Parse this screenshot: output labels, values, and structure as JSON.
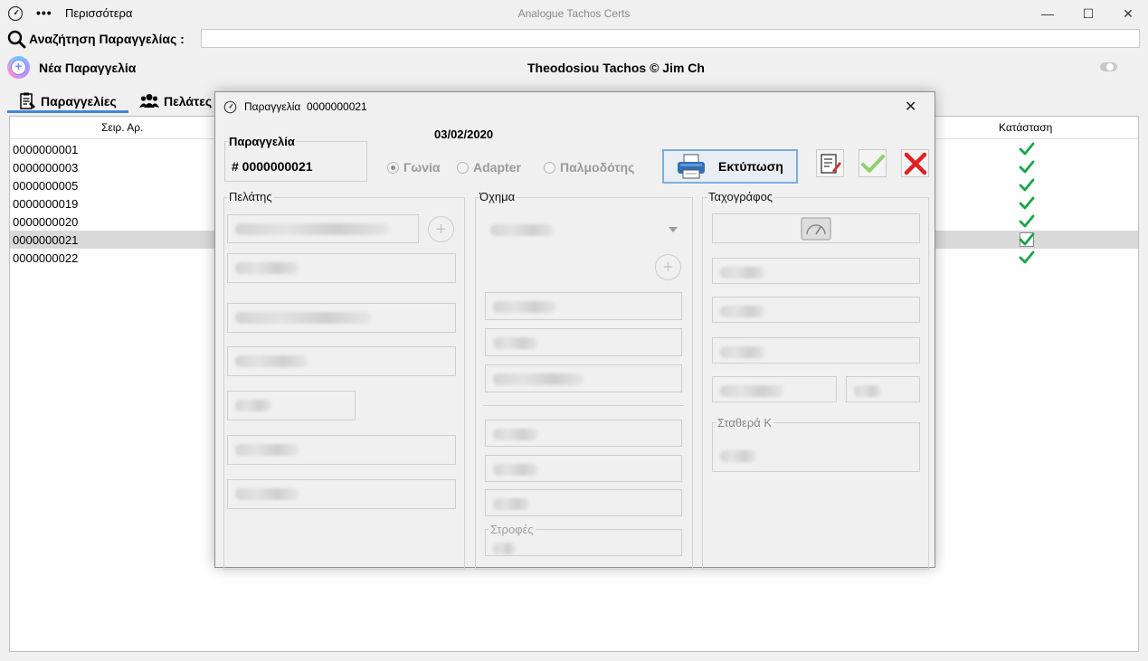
{
  "window": {
    "title": "Analogue Tachos Certs",
    "more_menu": "Περισσότερα",
    "minimize": "—",
    "maximize": "☐",
    "close": "✕"
  },
  "search": {
    "label": "Αναζήτηση Παραγγελίας :",
    "value": ""
  },
  "toolbar": {
    "new_order": "Νέα Παραγγελία",
    "brand": "Theodosiou Tachos © Jim Ch"
  },
  "tabs": [
    {
      "label": "Παραγγελίες",
      "icon": "orders-icon",
      "active": true
    },
    {
      "label": "Πελάτες",
      "icon": "customers-icon",
      "active": false
    }
  ],
  "table": {
    "columns": [
      "Σειρ. Αρ.",
      "Κατάσταση"
    ],
    "rows": [
      {
        "serial": "0000000001",
        "status": "done"
      },
      {
        "serial": "0000000003",
        "status": "done"
      },
      {
        "serial": "0000000005",
        "status": "done"
      },
      {
        "serial": "0000000019",
        "status": "done"
      },
      {
        "serial": "0000000020",
        "status": "done"
      },
      {
        "serial": "0000000021",
        "status": "done",
        "selected": true
      },
      {
        "serial": "0000000022",
        "status": "done"
      }
    ]
  },
  "dialog": {
    "title": "Παραγγελία  0000000021",
    "close": "✕",
    "order_legend": "Παραγγελία",
    "order_number": "# 0000000021",
    "date": "03/02/2020",
    "radios": [
      {
        "label": "Γωνία",
        "checked": true
      },
      {
        "label": "Adapter",
        "checked": false
      },
      {
        "label": "Παλμοδότης",
        "checked": false
      }
    ],
    "print_label": "Εκτύπωση",
    "groups": {
      "customer": "Πελάτης",
      "vehicle": "Όχημα",
      "tacho": "Ταχογράφος"
    },
    "vehicle_turns_legend": "Στροφές",
    "tacho_constant_legend": "Σταθερά Κ"
  },
  "colors": {
    "accent": "#3f87d8",
    "check": "#1aa34a",
    "cancel": "#e02020"
  }
}
